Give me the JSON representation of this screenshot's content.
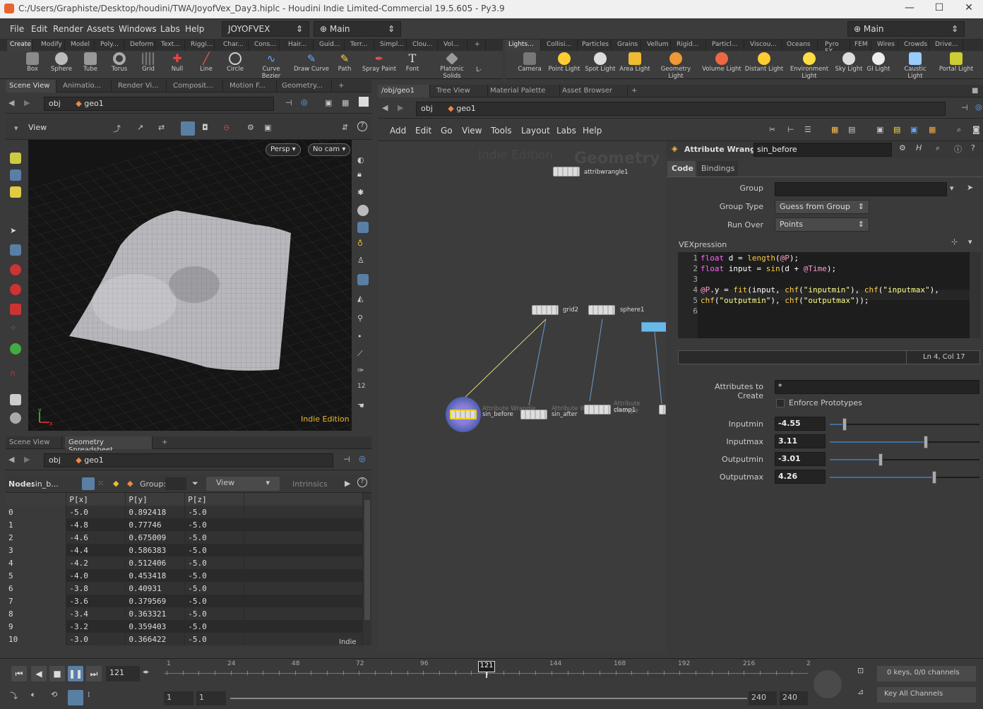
{
  "window": {
    "title": "C:/Users/Graphiste/Desktop/houdini/TWA/JoyofVex_Day3.hiplc - Houdini Indie Limited-Commercial 19.5.605 - Py3.9"
  },
  "menu": [
    "File",
    "Edit",
    "Render",
    "Assets",
    "Windows",
    "Labs",
    "Help"
  ],
  "desktop": {
    "name": "JOYOFVEX",
    "main": "Main",
    "right_main": "Main"
  },
  "shelf_tabs_left": [
    "Create",
    "Modify",
    "Model",
    "Poly...",
    "Deform",
    "Text...",
    "Riggi...",
    "Char...",
    "Cons...",
    "Hair...",
    "Guid...",
    "Terr...",
    "Simpl...",
    "Clou...",
    "Vol..."
  ],
  "shelf_tabs_right": [
    "Lights...",
    "Collisi...",
    "Particles",
    "Grains",
    "Vellum",
    "Rigid...",
    "Particl...",
    "Viscou...",
    "Oceans",
    "Pyro FX",
    "FEM",
    "Wires",
    "Crowds",
    "Drive..."
  ],
  "tools_left": [
    "Box",
    "Sphere",
    "Tube",
    "Torus",
    "Grid",
    "Null",
    "Line",
    "Circle",
    "Curve Bezier",
    "Draw Curve",
    "Path",
    "Spray Paint",
    "Font",
    "Platonic Solids",
    "L-"
  ],
  "tools_right": [
    "Camera",
    "Point Light",
    "Spot Light",
    "Area Light",
    "Geometry Light",
    "Volume Light",
    "Distant Light",
    "Environment Light",
    "Sky Light",
    "GI Light",
    "Caustic Light",
    "Portal Light"
  ],
  "viewer": {
    "tabs": [
      "Scene View",
      "Animatio...",
      "Render Vi...",
      "Composit...",
      "Motion F...",
      "Geometry..."
    ],
    "path_obj": "obj",
    "path_geo": "geo1",
    "view_label": "View",
    "persp": "Persp",
    "cam": "No cam",
    "watermark": "Indie Edition"
  },
  "spreadsheet": {
    "tabs": [
      "Scene View",
      "Geometry Spreadsheet"
    ],
    "path_obj": "obj",
    "path_geo": "geo1",
    "node_label": "Node:",
    "node_value": "sin_b...",
    "group_label": "Group:",
    "view_btn": "View",
    "intrinsics": "Intrinsics",
    "columns": [
      "",
      "P[x]",
      "P[y]",
      "P[z]"
    ],
    "rows": [
      [
        "0",
        "-5.0",
        "0.892418",
        "-5.0"
      ],
      [
        "1",
        "-4.8",
        "0.77746",
        "-5.0"
      ],
      [
        "2",
        "-4.6",
        "0.675009",
        "-5.0"
      ],
      [
        "3",
        "-4.4",
        "0.586383",
        "-5.0"
      ],
      [
        "4",
        "-4.2",
        "0.512406",
        "-5.0"
      ],
      [
        "5",
        "-4.0",
        "0.453418",
        "-5.0"
      ],
      [
        "6",
        "-3.8",
        "0.40931",
        "-5.0"
      ],
      [
        "7",
        "-3.6",
        "0.379569",
        "-5.0"
      ],
      [
        "8",
        "-3.4",
        "0.363321",
        "-5.0"
      ],
      [
        "9",
        "-3.2",
        "0.359403",
        "-5.0"
      ],
      [
        "10",
        "-3.0",
        "0.366422",
        "-5.0"
      ]
    ],
    "watermark": "Indie"
  },
  "network": {
    "tabs": [
      "/obj/geo1",
      "Tree View",
      "Material Palette",
      "Asset Browser"
    ],
    "path_obj": "obj",
    "path_geo": "geo1",
    "menu": [
      "Add",
      "Edit",
      "Go",
      "View",
      "Tools",
      "Layout",
      "Labs",
      "Help"
    ],
    "watermark1": "Indie Edition",
    "watermark2": "Geometry",
    "nodes": {
      "attribwrangle1": "attribwrangle1",
      "grid2": "grid2",
      "sphere1": "sphere1",
      "sin_before": "sin_before",
      "sin_after": "sin_after",
      "clamp1": "clamp1",
      "aw_type": "Attribute Wrangle"
    }
  },
  "params": {
    "type": "Attribute Wrangle",
    "name": "sin_before",
    "tabs": [
      "Code",
      "Bindings"
    ],
    "group_label": "Group",
    "group_value": "",
    "group_type_label": "Group Type",
    "group_type_value": "Guess from Group",
    "run_over_label": "Run Over",
    "run_over_value": "Points",
    "vex_label": "VEXpression",
    "code_lines": [
      "1",
      "2",
      "3",
      "4",
      "5",
      "6"
    ],
    "status": "Ln 4, Col 17",
    "attr_create_label": "Attributes to Create",
    "attr_create_value": "*",
    "enforce_label": "Enforce Prototypes",
    "sliders": [
      {
        "label": "Inputmin",
        "value": "-4.55",
        "pos": 0.1
      },
      {
        "label": "Inputmax",
        "value": "3.11",
        "pos": 0.64
      },
      {
        "label": "Outputmin",
        "value": "-3.01",
        "pos": 0.34
      },
      {
        "label": "Outputmax",
        "value": "4.26",
        "pos": 0.7
      }
    ]
  },
  "timeline": {
    "frame": "121",
    "marker": "121",
    "ticks": [
      "1",
      "24",
      "48",
      "72",
      "96",
      "144",
      "168",
      "192",
      "216",
      "2"
    ],
    "start": "1",
    "start2": "1",
    "end": "240",
    "end2": "240",
    "keys": "0 keys, 0/0 channels",
    "key_all": "Key All Channels"
  }
}
